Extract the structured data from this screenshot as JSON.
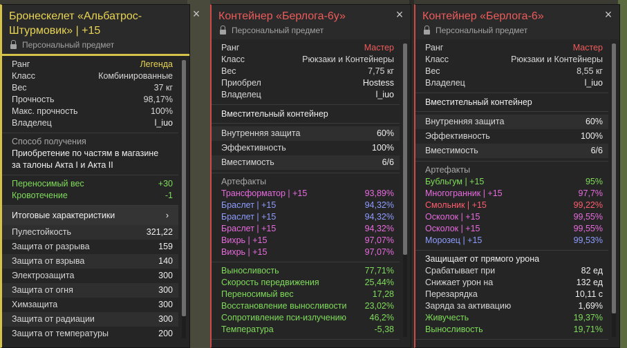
{
  "panel1": {
    "title": "Бронескелет «Альбатрос-Штурмовик» | +15",
    "subtitle": "Персональный предмет",
    "info": [
      {
        "k": "Ранг",
        "v": "Легенда",
        "c": "gold"
      },
      {
        "k": "Класс",
        "v": "Комбинированные"
      },
      {
        "k": "Вес",
        "v": "37 кг"
      },
      {
        "k": "Прочность",
        "v": "98,17%"
      },
      {
        "k": "Макс. прочность",
        "v": "100%"
      },
      {
        "k": "Владелец",
        "v": "l_iuo",
        "c": "white-v"
      }
    ],
    "source_label": "Способ получения",
    "source_text": "Приобретение по частям в магазине за талоны Акта I и Акта II",
    "effects": [
      {
        "k": "Переносимый вес",
        "v": "+30",
        "c": "green"
      },
      {
        "k": "Кровотечение",
        "v": "-1",
        "c": "green"
      }
    ],
    "summary_label": "Итоговые характеристики",
    "summary_arrow": "›",
    "stats": [
      {
        "k": "Пулестойкость",
        "v": "321,22"
      },
      {
        "k": "Защита от разрыва",
        "v": "159"
      },
      {
        "k": "Защита от взрыва",
        "v": "140"
      },
      {
        "k": "Электрозащита",
        "v": "300"
      },
      {
        "k": "Защита от огня",
        "v": "300"
      },
      {
        "k": "Химзащита",
        "v": "300"
      },
      {
        "k": "Защита от радиации",
        "v": "300"
      },
      {
        "k": "Защита от температуры",
        "v": "200"
      }
    ]
  },
  "panel2": {
    "title": "Контейнер «Берлога-6у»",
    "subtitle": "Персональный предмет",
    "info": [
      {
        "k": "Ранг",
        "v": "Мастер",
        "c": "red"
      },
      {
        "k": "Класс",
        "v": "Рюкзаки и Контейнеры"
      },
      {
        "k": "Вес",
        "v": "7,75 кг"
      },
      {
        "k": "Приобрел",
        "v": "Hostess",
        "c": "white-v"
      },
      {
        "k": "Владелец",
        "v": "l_iuo",
        "c": "white-v"
      }
    ],
    "section_title": "Вместительный контейнер",
    "container": [
      {
        "k": "Внутренняя защита",
        "v": "60%"
      },
      {
        "k": "Эффективность",
        "v": "100%"
      },
      {
        "k": "Вместимость",
        "v": "6/6"
      }
    ],
    "artifacts_label": "Артефакты",
    "artifacts": [
      {
        "k": "Трансформатор | +15",
        "v": "93,89%",
        "c": "pink"
      },
      {
        "k": "Браслет | +15",
        "v": "94,32%",
        "c": "blue"
      },
      {
        "k": "Браслет | +15",
        "v": "94,32%",
        "c": "blue"
      },
      {
        "k": "Браслет | +15",
        "v": "94,32%",
        "c": "pink"
      },
      {
        "k": "Вихрь | +15",
        "v": "97,07%",
        "c": "pink"
      },
      {
        "k": "Вихрь | +15",
        "v": "97,07%",
        "c": "pink"
      }
    ],
    "bonuses": [
      {
        "k": "Выносливость",
        "v": "77,71%",
        "c": "green"
      },
      {
        "k": "Скорость передвижения",
        "v": "25,44%",
        "c": "green"
      },
      {
        "k": "Переносимый вес",
        "v": "17,28",
        "c": "green"
      },
      {
        "k": "Восстановление выносливости",
        "v": "23,02%",
        "c": "green"
      },
      {
        "k": "Сопротивление пси-излучению",
        "v": "46,2%",
        "c": "green"
      },
      {
        "k": "Температура",
        "v": "-5,38",
        "c": "green"
      }
    ]
  },
  "panel3": {
    "title": "Контейнер «Берлога-6»",
    "subtitle": "Персональный предмет",
    "info": [
      {
        "k": "Ранг",
        "v": "Мастер",
        "c": "red"
      },
      {
        "k": "Класс",
        "v": "Рюкзаки и Контейнеры"
      },
      {
        "k": "Вес",
        "v": "8,55 кг"
      },
      {
        "k": "Владелец",
        "v": "l_iuo",
        "c": "white-v"
      }
    ],
    "section_title": "Вместительный контейнер",
    "container": [
      {
        "k": "Внутренняя защита",
        "v": "60%"
      },
      {
        "k": "Эффективность",
        "v": "100%"
      },
      {
        "k": "Вместимость",
        "v": "6/6"
      }
    ],
    "artifacts_label": "Артефакты",
    "artifacts": [
      {
        "k": "Бубльгум | +15",
        "v": "95%",
        "c": "green"
      },
      {
        "k": "Многогранник | +15",
        "v": "97,7%",
        "c": "pink"
      },
      {
        "k": "Смольник | +15",
        "v": "99,22%",
        "c": "salmon"
      },
      {
        "k": "Осколок | +15",
        "v": "99,55%",
        "c": "pink"
      },
      {
        "k": "Осколок | +15",
        "v": "99,55%",
        "c": "pink"
      },
      {
        "k": "Морозец | +15",
        "v": "99,53%",
        "c": "blue"
      }
    ],
    "protect_title": "Защищает от прямого урона",
    "protect": [
      {
        "k": "Срабатывает при",
        "v": "82 ед"
      },
      {
        "k": "Снижает урон на",
        "v": "132 ед"
      },
      {
        "k": "Перезарядка",
        "v": "10,11 с"
      },
      {
        "k": "Заряда за активацию",
        "v": "1,69%"
      },
      {
        "k": "Живучесть",
        "v": "19,37%",
        "c": "green"
      },
      {
        "k": "Выносливость",
        "v": "19,71%",
        "c": "green"
      }
    ]
  }
}
